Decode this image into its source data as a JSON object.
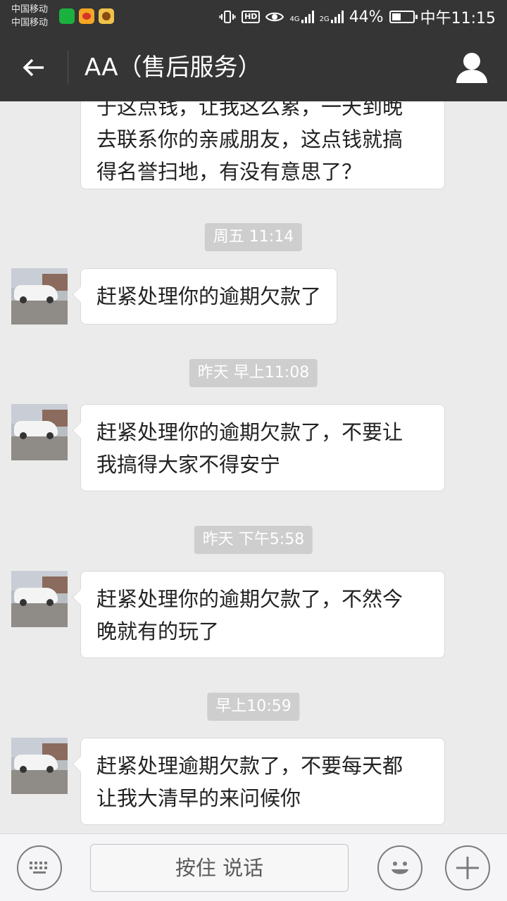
{
  "status_bar": {
    "carrier_1": "中国移动",
    "carrier_2": "中国移动",
    "app_icons": [
      "iqiyi-icon",
      "weibo-icon",
      "game-icon"
    ],
    "hd": "HD",
    "net_1": "4G",
    "net_2": "2G",
    "battery_text": "44%",
    "battery_level": 0.44,
    "time": "中午11:15"
  },
  "header": {
    "title": "AA（售后服务）",
    "back_icon": "back-arrow-icon",
    "profile_icon": "person-icon"
  },
  "messages": [
    {
      "text": "于这点钱，让我这么累，一天到晚去联系你的亲戚朋友，这点钱就搞得名誉扫地，有没有意思了？",
      "lines": [
        "于这点钱，让我这么累，一天到晚",
        "去联系你的亲戚朋友，这点钱就搞",
        "得名誉扫地，有没有意思了？"
      ]
    },
    {
      "timestamp": "周五 11:14",
      "text": "赶紧处理你的逾期欠款了"
    },
    {
      "timestamp": "昨天 早上11:08",
      "lines": [
        "赶紧处理你的逾期欠款了，不要让",
        "我搞得大家不得安宁"
      ]
    },
    {
      "timestamp": "昨天 下午5:58",
      "lines": [
        "赶紧处理你的逾期欠款了，不然今",
        "晚就有的玩了"
      ]
    },
    {
      "timestamp": "早上10:59",
      "lines": [
        "赶紧处理逾期欠款了，不要每天都",
        "让我大清早的来问候你"
      ]
    }
  ],
  "input_bar": {
    "keyboard_icon": "keyboard-icon",
    "hold_to_talk": "按住 说话",
    "emoji_icon": "emoji-icon",
    "plus_icon": "plus-icon"
  },
  "colors": {
    "header_bg": "#353535",
    "chat_bg": "#ebebeb",
    "bubble_bg": "#ffffff",
    "timestamp_bg": "#cecece"
  }
}
